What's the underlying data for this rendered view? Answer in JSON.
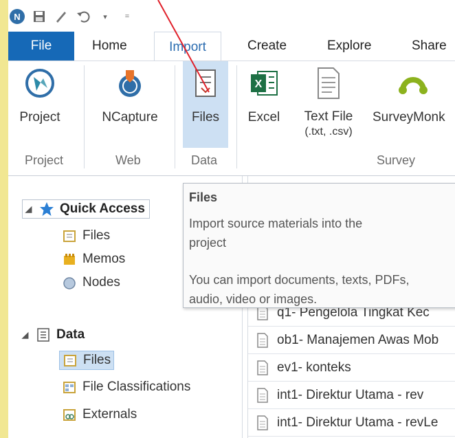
{
  "qat": {
    "icons": [
      "app-icon",
      "save-icon",
      "edit-icon",
      "undo-icon",
      "dropdown-icon",
      "customize-icon"
    ]
  },
  "tabs": [
    "File",
    "Home",
    "Import",
    "Create",
    "Explore",
    "Share"
  ],
  "ribbon": {
    "buttons": {
      "project": "Project",
      "ncapture": "NCapture",
      "files": "Files",
      "excel": "Excel",
      "textfile_line1": "Text File",
      "textfile_line2": "(.txt, .csv)",
      "surveymonkey": "SurveyMonk"
    },
    "groups": {
      "project": "Project",
      "web": "Web",
      "data": "Data",
      "survey": "Survey"
    }
  },
  "nav": {
    "quick_access": "Quick Access",
    "qa_files": "Files",
    "qa_memos": "Memos",
    "qa_nodes": "Nodes",
    "data": "Data",
    "data_files": "Files",
    "data_file_classifications": "File Classifications",
    "data_externals": "Externals"
  },
  "tooltip": {
    "title": "Files",
    "line1": "Import source materials into the",
    "line2": "project",
    "line3": "You can import documents, texts, PDFs,",
    "line4": "audio, video or images."
  },
  "files": [
    "q1- Pengelola Tingkat Kec",
    "ob1- Manajemen Awas Mob",
    "ev1- konteks",
    "int1- Direktur Utama - rev",
    "int1- Direktur Utama - revLe"
  ],
  "colors": {
    "accent": "#1669b7",
    "selection": "#cde0f3",
    "background": "#f1e792",
    "annotation": "#e0202a"
  }
}
